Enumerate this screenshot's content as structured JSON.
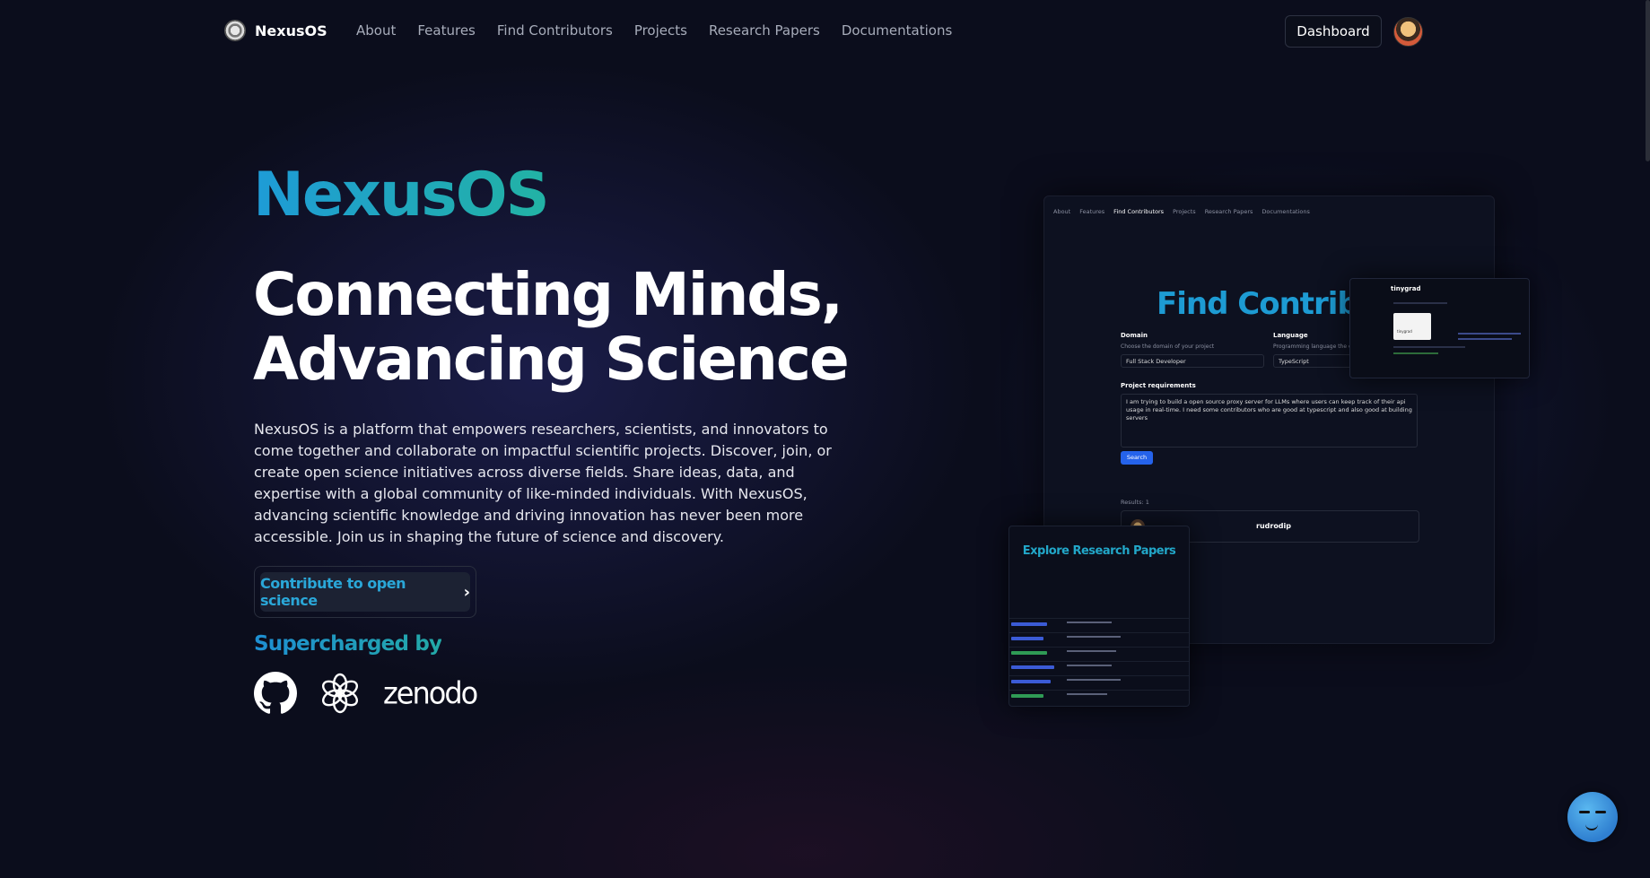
{
  "nav": {
    "brand": "NexusOS",
    "links": [
      "About",
      "Features",
      "Find Contributors",
      "Projects",
      "Research Papers",
      "Documentations"
    ],
    "dashboard_label": "Dashboard"
  },
  "hero": {
    "brand_title": "NexusOS",
    "headline_line1": "Connecting Minds,",
    "headline_line2": "Advancing Science",
    "description": "NexusOS is a platform that empowers researchers, scientists, and innovators to come together and collaborate on impactful scientific projects. Discover, join, or create open science initiatives across diverse fields. Share ideas, data, and expertise with a global community of like-minded individuals. With NexusOS, advancing scientific knowledge and driving innovation has never been more accessible. Join us in shaping the future of science and discovery.",
    "cta_label": "Contribute to open science",
    "supercharged_label": "Supercharged by",
    "partner_logos": [
      "github-icon",
      "openai-icon",
      "zenodo"
    ],
    "zenodo_text": "zenodo"
  },
  "preview_find_contributors": {
    "nav": [
      "About",
      "Features",
      "Find Contributors",
      "Projects",
      "Research Papers",
      "Documentations"
    ],
    "title": "Find Contributors",
    "domain_label": "Domain",
    "domain_sub": "Choose the domain of your project",
    "domain_value": "Full Stack Developer",
    "language_label": "Language",
    "language_sub": "Programming language the co",
    "language_value": "TypeScript",
    "requirements_label": "Project requirements",
    "requirements_value": "I am trying to build a open source proxy server for LLMs where users can keep track of their api usage in real-time. I need some contributors who are good at typescript and also good at building servers",
    "search_label": "Search",
    "results_label": "Results: 1",
    "result_name": "rudrodip"
  },
  "preview_profile": {
    "name": "tinygrad",
    "image_caption": "tinygrad"
  },
  "preview_papers": {
    "title": "Explore Research Papers"
  },
  "colors": {
    "background": "#0b0d1c",
    "brand_gradient_start": "#1e9bd7",
    "brand_gradient_end": "#22b3a4",
    "search_button": "#2563eb"
  }
}
